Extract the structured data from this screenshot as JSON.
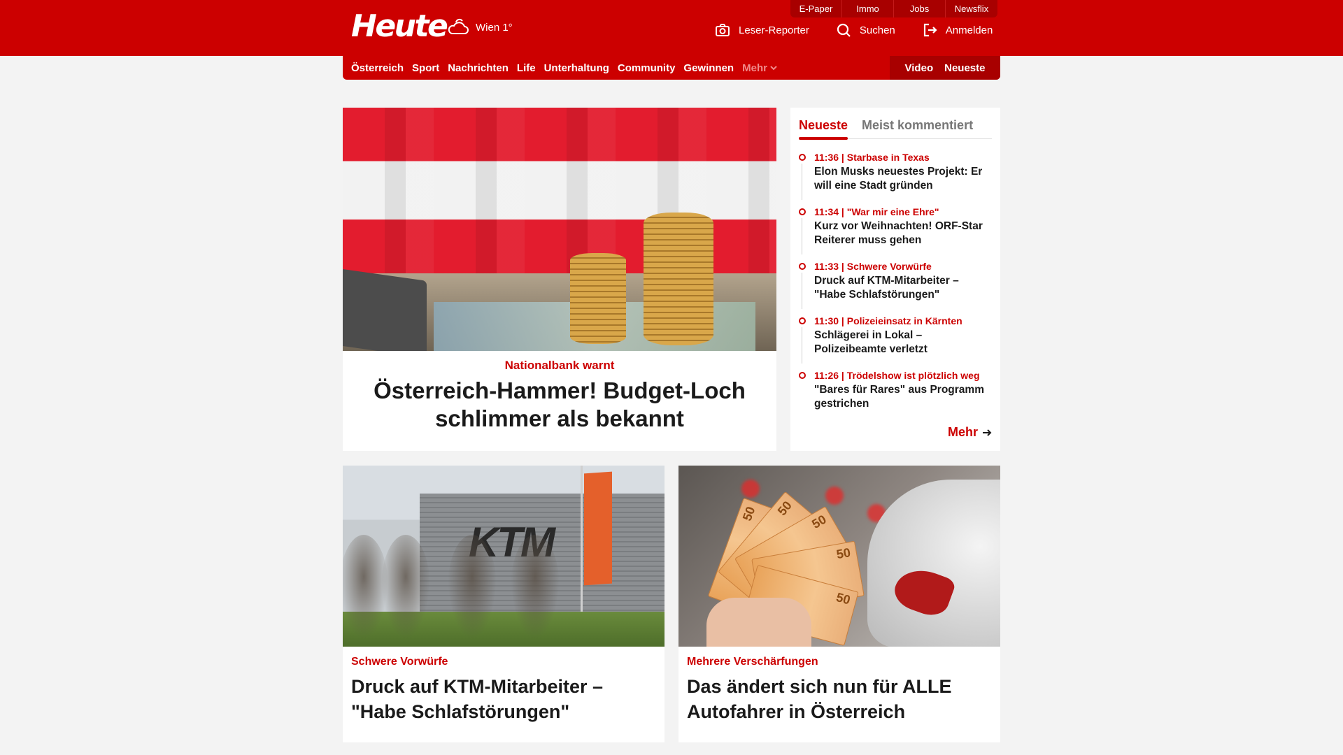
{
  "header": {
    "logo": "Heute",
    "weather": "Wien 1°",
    "topnav": [
      "E-Paper",
      "Immo",
      "Jobs",
      "Newsflix"
    ],
    "tools": {
      "reporter": "Leser-Reporter",
      "search": "Suchen",
      "login": "Anmelden"
    },
    "brand_color": "#cc0000"
  },
  "nav": {
    "items": [
      "Österreich",
      "Sport",
      "Nachrichten",
      "Life",
      "Unterhaltung",
      "Community",
      "Gewinnen"
    ],
    "more": "Mehr",
    "right": [
      "Video",
      "Neueste"
    ]
  },
  "hero": {
    "kicker": "Nationalbank warnt",
    "title": "Österreich-Hammer! Budget-Loch schlimmer als bekannt"
  },
  "sidebar": {
    "tabs": [
      "Neueste",
      "Meist kommentiert"
    ],
    "items": [
      {
        "meta": "11:36 | Starbase in Texas",
        "headline": "Elon Musks neuestes Projekt: Er will eine Stadt gründen"
      },
      {
        "meta": "11:34 | \"War mir eine Ehre\"",
        "headline": "Kurz vor Weihnachten! ORF-Star Reiterer muss gehen"
      },
      {
        "meta": "11:33 | Schwere Vorwürfe",
        "headline": "Druck auf KTM-Mitarbeiter – \"Habe Schlafstörungen\""
      },
      {
        "meta": "11:30 | Polizeieinsatz in Kärnten",
        "headline": "Schlägerei in Lokal – Polizeibeamte verletzt"
      },
      {
        "meta": "11:26 | Trödelshow ist plötzlich weg",
        "headline": "\"Bares für Rares\" aus Programm gestrichen"
      }
    ],
    "more": "Mehr"
  },
  "cards": [
    {
      "kicker": "Schwere Vorwürfe",
      "title": "Druck auf KTM-Mitarbeiter – \"Habe Schlafstörungen\"",
      "logo_text": "KTM"
    },
    {
      "kicker": "Mehrere Verschärfungen",
      "title": "Das ändert sich nun für ALLE Autofahrer in Österreich",
      "bill_value": "50"
    }
  ]
}
